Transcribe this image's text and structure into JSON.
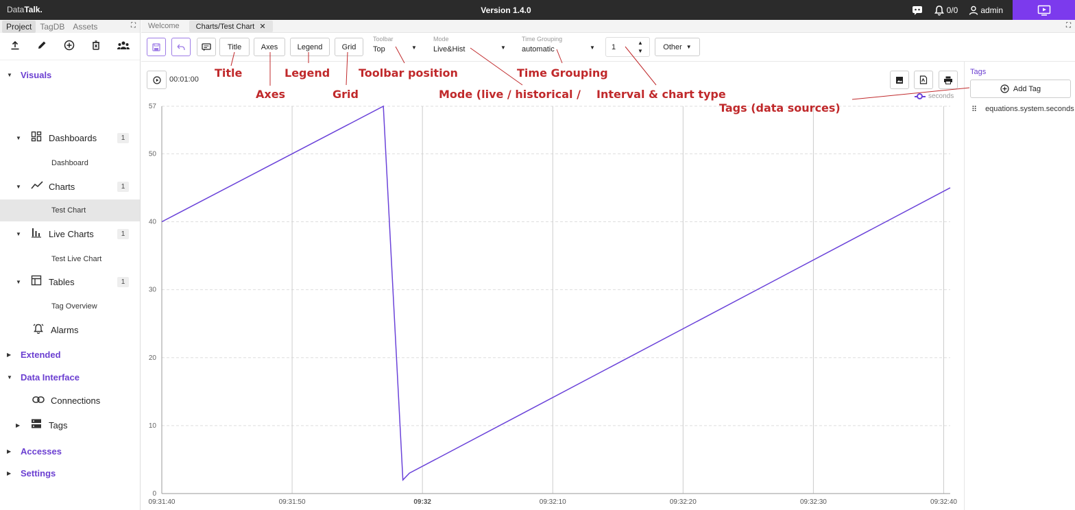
{
  "app": {
    "brand_prefix": "Data",
    "brand_bold": "Talk.",
    "version": "Version 1.4.0",
    "alarm_count": "0/0",
    "user": "admin"
  },
  "sidebar": {
    "tabs": [
      "Project",
      "TagDB",
      "Assets"
    ],
    "sections": {
      "visuals": "Visuals",
      "dashboards": "Dashboards",
      "dashboards_count": "1",
      "dashboard": "Dashboard",
      "charts": "Charts",
      "charts_count": "1",
      "test_chart": "Test Chart",
      "live_charts": "Live Charts",
      "live_charts_count": "1",
      "test_live_chart": "Test Live Chart",
      "tables": "Tables",
      "tables_count": "1",
      "tag_overview": "Tag Overview",
      "alarms": "Alarms",
      "extended": "Extended",
      "data_interface": "Data Interface",
      "connections": "Connections",
      "tags": "Tags",
      "accesses": "Accesses",
      "settings": "Settings"
    }
  },
  "doc_tabs": {
    "welcome": "Welcome",
    "active": "Charts/Test Chart"
  },
  "toolbar": {
    "title": "Title",
    "axes": "Axes",
    "legend": "Legend",
    "grid": "Grid",
    "toolbar_label": "Toolbar",
    "toolbar_value": "Top",
    "mode_label": "Mode",
    "mode_value": "Live&Hist",
    "tg_label": "Time Grouping",
    "tg_value": "automatic",
    "interval_value": "1",
    "other": "Other"
  },
  "chart": {
    "timer": "00:01:00",
    "legend_series": "seconds"
  },
  "tags_panel": {
    "title": "Tags",
    "add": "Add Tag",
    "item": "equations.system.seconds"
  },
  "annotations": {
    "title": "Title",
    "axes": "Axes",
    "legend": "Legend",
    "grid": "Grid",
    "toolbar_position": "Toolbar position",
    "mode": "Mode (live / historical /",
    "time_grouping": "Time Grouping",
    "interval": "Interval & chart type",
    "tags": "Tags (data sources)"
  },
  "chart_data": {
    "type": "line",
    "x": [
      "09:31:40",
      "09:31:57",
      "09:31:58.5",
      "09:31:59",
      "09:32:40.5"
    ],
    "series": [
      {
        "name": "seconds",
        "values": [
          40,
          57,
          2,
          3,
          45
        ],
        "color": "#6a42d9"
      }
    ],
    "xticks": [
      "09:31:40",
      "09:31:50",
      "09:32",
      "09:32:10",
      "09:32:20",
      "09:32:30",
      "09:32:40"
    ],
    "yticks": [
      0,
      10,
      20,
      30,
      40,
      50,
      57
    ],
    "ylim": [
      0,
      57
    ],
    "xlim_seconds": [
      0,
      60.5
    ],
    "grid": true,
    "legend_position": "top-right"
  }
}
